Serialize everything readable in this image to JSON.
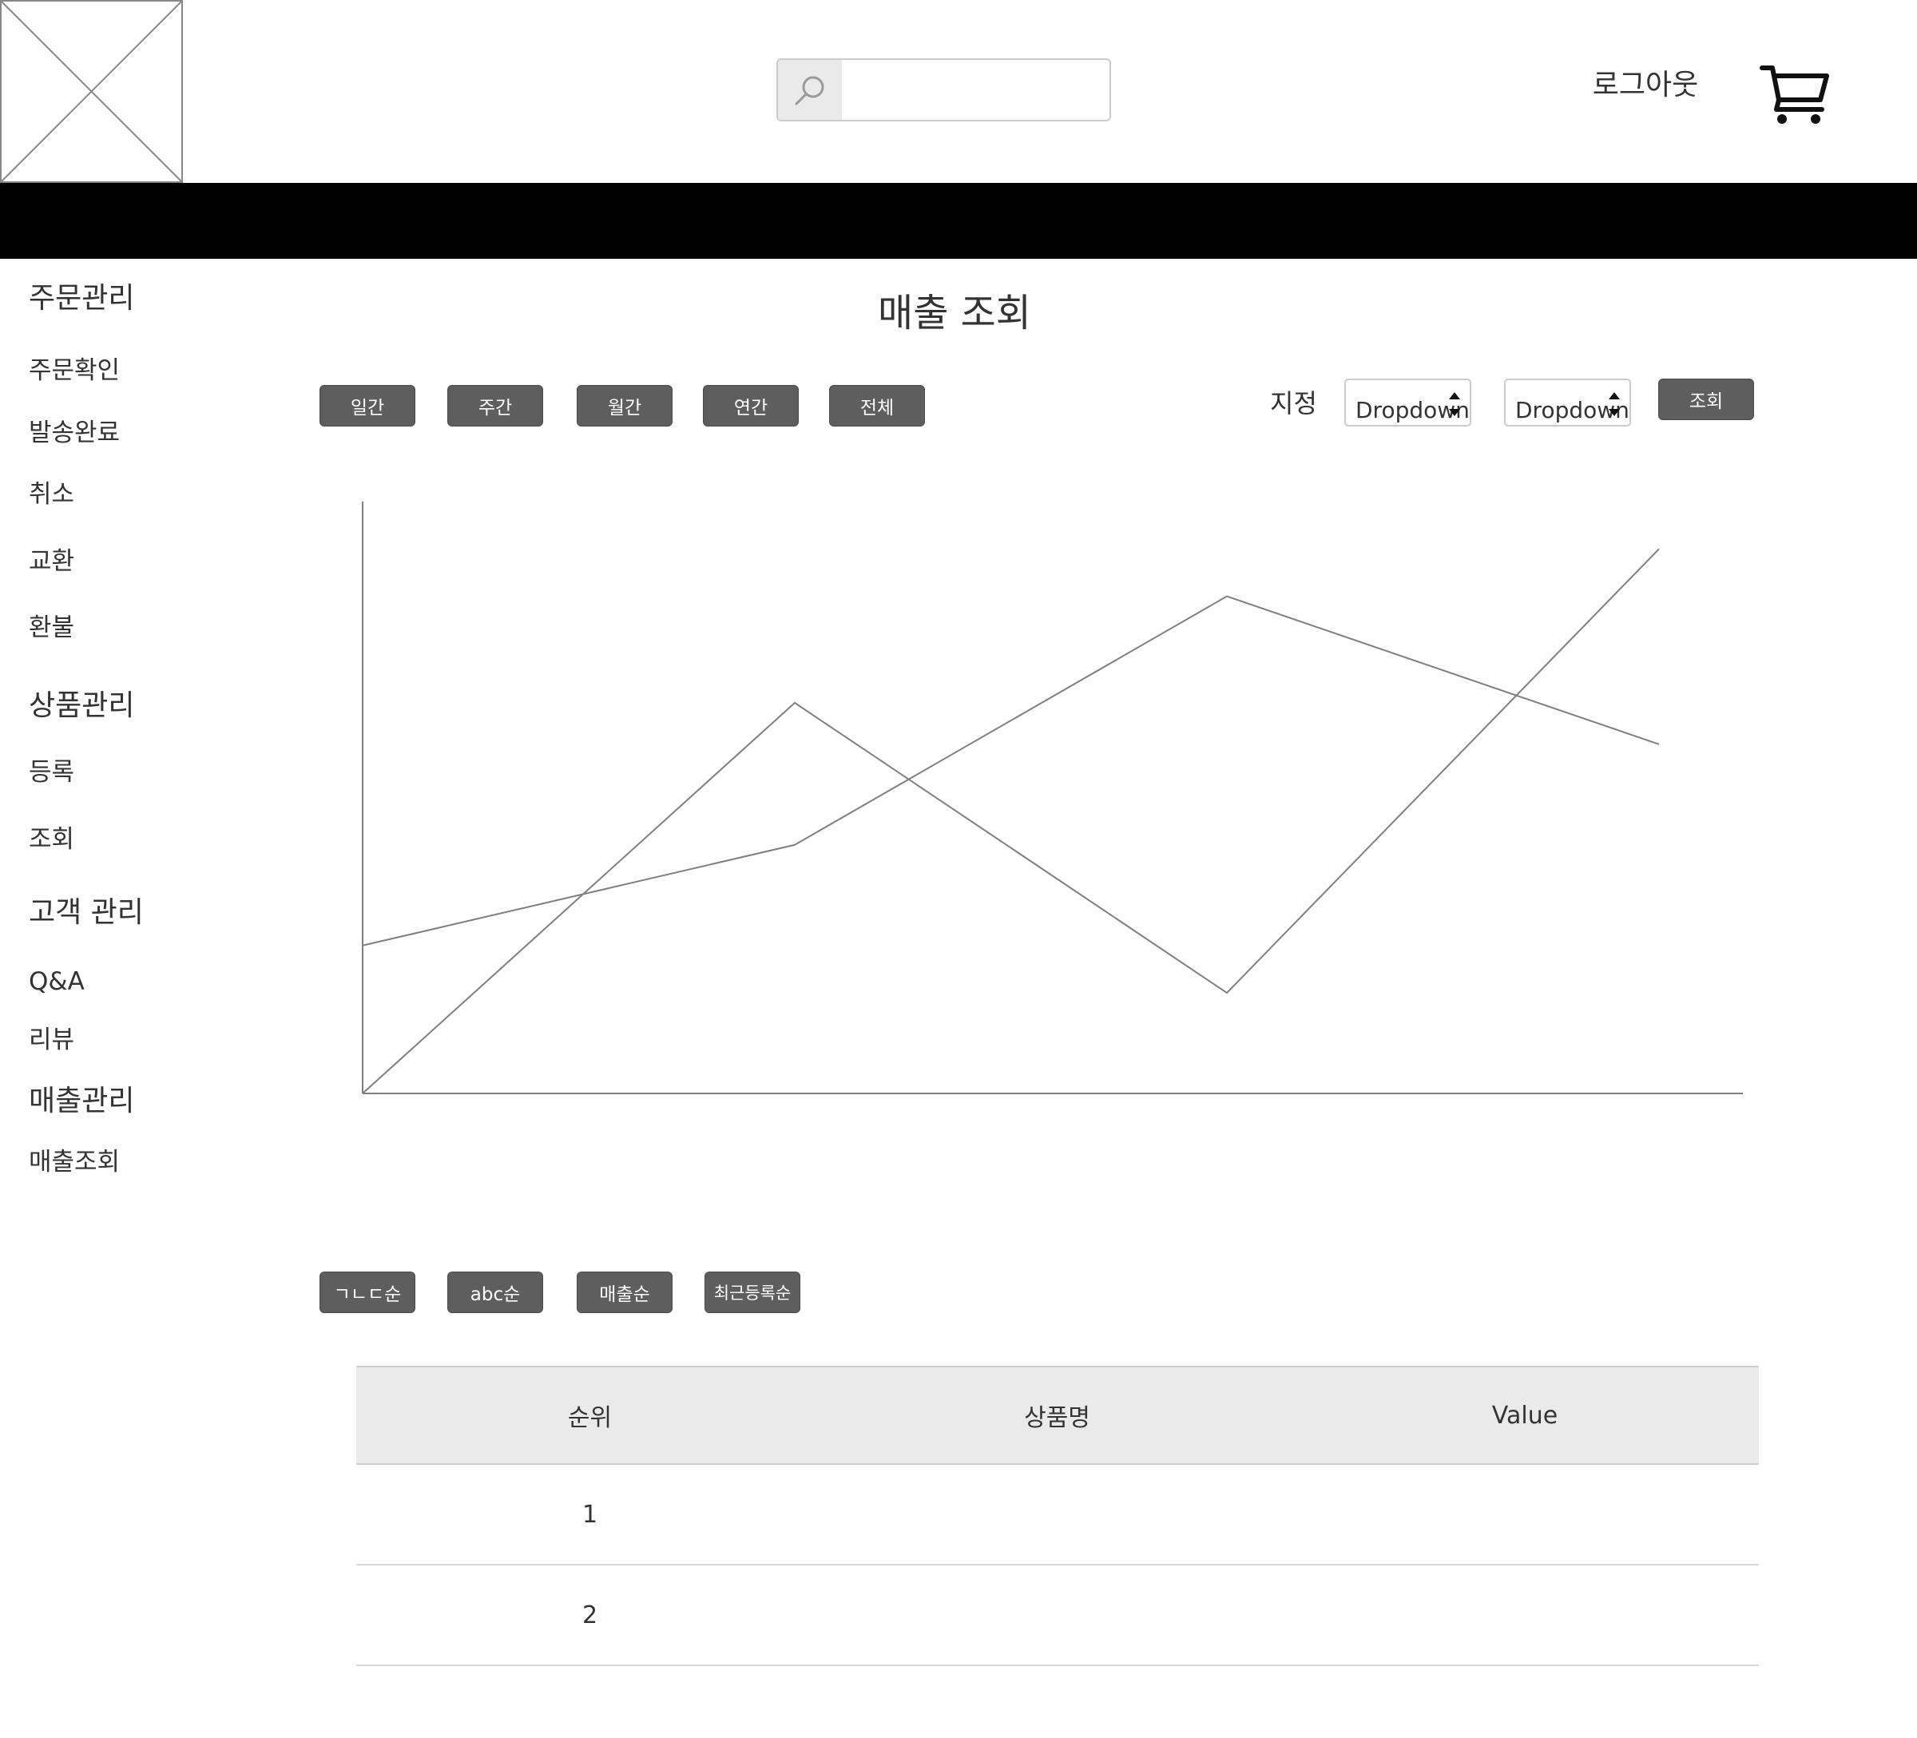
{
  "header": {
    "logout_label": "로그아웃",
    "search": {
      "value": "",
      "placeholder": ""
    },
    "icons": {
      "search": "search-icon",
      "cart": "cart-icon",
      "logo": "image-placeholder-icon"
    }
  },
  "sidebar": {
    "order_mgmt": {
      "title": "주문관리",
      "items": [
        "주문확인",
        "발송완료",
        "취소",
        "교환",
        "환불"
      ]
    },
    "product_mgmt": {
      "title": "상품관리",
      "items": [
        "등록",
        "조회"
      ]
    },
    "customer_mgmt": {
      "title": "고객 관리",
      "items": [
        "Q&A",
        "리뷰"
      ]
    },
    "sales_mgmt": {
      "title": "매출관리",
      "items": [
        "매출조회"
      ]
    }
  },
  "main": {
    "title": "매출 조회",
    "period_buttons": [
      "일간",
      "주간",
      "월간",
      "연간",
      "전체"
    ],
    "range_label": "지정",
    "dropdowns": [
      "Dropdown",
      "Dropdown"
    ],
    "query_button": "조회",
    "sort_buttons": [
      "ㄱㄴㄷ순",
      "abc순",
      "매출순",
      "최근등록순"
    ],
    "table": {
      "headers": [
        "순위",
        "상품명",
        "Value"
      ],
      "rows": [
        [
          "1",
          "",
          ""
        ],
        [
          "2",
          "",
          ""
        ]
      ]
    }
  },
  "colors": {
    "nav_bar": "#000000",
    "button_fill": "#5e5e5e",
    "table_header": "#eaeaea",
    "chart_line": "#7f7f7f"
  },
  "chart_data": {
    "type": "line",
    "title": "",
    "xlabel": "",
    "ylabel": "",
    "x": [
      0,
      1,
      2,
      3,
      4
    ],
    "ylim": [
      0,
      100
    ],
    "grid": false,
    "series": [
      {
        "values": [
          0,
          66,
          17,
          92
        ]
      },
      {
        "values": [
          25,
          42,
          84,
          59
        ]
      }
    ]
  }
}
